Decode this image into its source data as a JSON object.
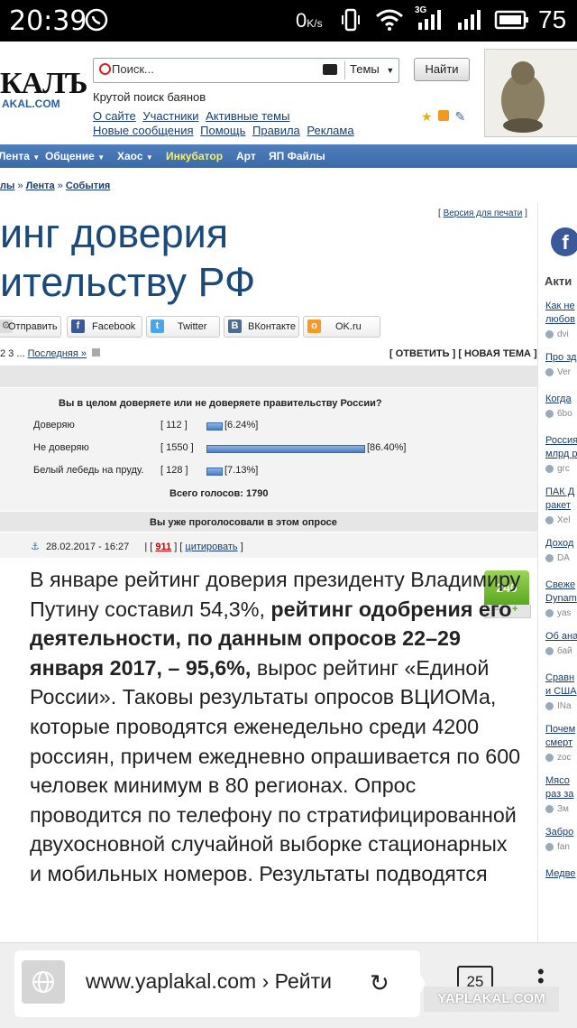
{
  "status_bar": {
    "time": "20:39",
    "net_speed": "0",
    "net_unit": "K/s",
    "net_type": "3G",
    "battery": "75"
  },
  "header": {
    "logo": "КАЛЪ",
    "logo_sub": "AKAL.COM",
    "search_placeholder": "Поиск...",
    "search_scope": "Темы",
    "search_button": "Найти",
    "tagline": "Крутой поиск баянов",
    "links_row1": [
      "О сайте",
      "Участники",
      "Активные темы"
    ],
    "links_row2": [
      "Новые сообщения",
      "Помощь",
      "Правила",
      "Реклама"
    ]
  },
  "nav": [
    "Лента",
    "Общение",
    "Хаос",
    "Инкубатор",
    "Арт",
    "ЯП Файлы"
  ],
  "breadcrumbs": [
    "лы",
    "Лента",
    "События"
  ],
  "print_link": "Версия для печати",
  "post": {
    "title_line1": "инг доверия",
    "title_line2": "ительству РФ",
    "share": [
      "Отправить",
      "Facebook",
      "Twitter",
      "ВКонтакте",
      "OK.ru"
    ],
    "pages": "2 3 ...",
    "last_page": "Последняя »",
    "reply": "[ ОТВЕТИТЬ ]",
    "new_topic": "[ НОВАЯ ТЕМА ]",
    "date": "28.02.2017 - 16:27",
    "post_number": "911",
    "quote": "цитировать",
    "rating": "240",
    "rating_minus": "–",
    "rating_plus": "+",
    "body_plain_1": "В январе рейтинг доверия президенту Владимиру Путину составил 54,3%,",
    "body_bold": "рейтинг одобрения его деятельности, по данным опросов 22–29 января 2017, – 95,6%,",
    "body_plain_2": "вырос рейтинг «Единой России». Таковы результаты опросов ВЦИОМа, которые проводятся еженедельно среди 4200 россиян, причем ежедневно опрашивается по 600 человек минимум в 80 регионах. Опрос проводится по телефону по стратифицированной двухосновной случайной выборке стационарных и мобильных номеров. Результаты подводятся"
  },
  "poll": {
    "question": "Вы в целом доверяете или не доверяете правительству России?",
    "options": [
      {
        "label": "Доверяю",
        "count": "[ 112 ]",
        "pct": "[6.24%]",
        "share": 6.24
      },
      {
        "label": "Не доверяю",
        "count": "[ 1550 ]",
        "pct": "[86.40%]",
        "share": 86.4
      },
      {
        "label": "Белый лебедь на пруду.",
        "count": "[ 128 ]",
        "pct": "[7.13%]",
        "share": 7.13
      }
    ],
    "total": "Всего голосов: 1790",
    "voted": "Вы уже проголосовали в этом опросе"
  },
  "sidebar": {
    "fb": "f",
    "heading": "Акти",
    "items": [
      {
        "title": "Как не",
        "title2": "любов",
        "user": "dvi"
      },
      {
        "title": "Про зд",
        "title2": "",
        "user": "Ver"
      },
      {
        "title": "Когда",
        "title2": "",
        "user": "6bo"
      },
      {
        "title": "Россия",
        "title2": "млрд р",
        "user": "grc"
      },
      {
        "title": "ПАК Д",
        "title2": "ракет",
        "user": "Xel"
      },
      {
        "title": "Доход",
        "title2": "",
        "user": "DA"
      },
      {
        "title": "Свеже",
        "title2": "Dynam",
        "user": "yas"
      },
      {
        "title": "Об ана",
        "title2": "",
        "user": "бай"
      },
      {
        "title": "Сравн",
        "title2": "и США",
        "user": "INa"
      },
      {
        "title": "Почем",
        "title2": "смерт",
        "user": "zoc"
      },
      {
        "title": "Мясо",
        "title2": "раз за",
        "user": "Зм"
      },
      {
        "title": "Забро",
        "title2": "",
        "user": "fan"
      },
      {
        "title": "Медве",
        "title2": "",
        "user": ""
      }
    ]
  },
  "browser": {
    "url": "www.yaplakal.com › Рейти",
    "tabs": "25",
    "watermark": "YAPLAKAL.COM"
  }
}
